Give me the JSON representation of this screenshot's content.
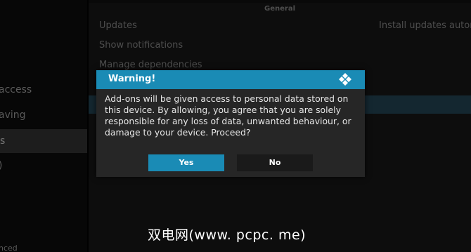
{
  "sidebar": {
    "items": [
      {
        "label": "access"
      },
      {
        "label": "aving"
      },
      {
        "label": "s"
      },
      {
        "label": ")"
      },
      {
        "label": "nced"
      }
    ]
  },
  "main": {
    "section_title": "General",
    "settings": [
      {
        "label": "Updates",
        "value": "Install updates autom"
      },
      {
        "label": "Show notifications"
      },
      {
        "label": "Manage dependencies"
      }
    ]
  },
  "dialog": {
    "title": "Warning!",
    "message": "Add-ons will be given access to personal data stored on this device. By allowing, you agree that you are solely responsible for any loss of data, unwanted behaviour, or damage to your device. Proceed?",
    "yes_label": "Yes",
    "no_label": "No"
  },
  "watermark": "双电网(www. pcpc. me)",
  "colors": {
    "accent": "#1a8bb5",
    "dialog_bg": "#262626",
    "background": "#020202"
  },
  "icons": {
    "dialog_logo": "kodi-logo-icon"
  }
}
